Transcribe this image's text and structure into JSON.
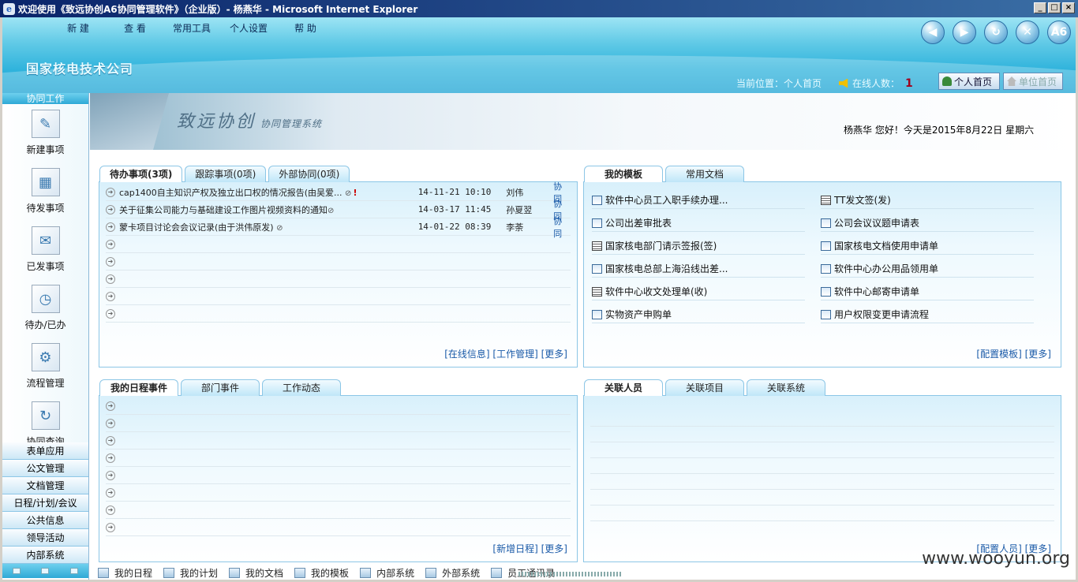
{
  "window": {
    "title": "欢迎使用《致远协创A6协同管理软件》（企业版）- 杨燕华 - Microsoft Internet Explorer",
    "buttons": [
      "_",
      "□",
      "×"
    ]
  },
  "header": {
    "menu": [
      "新 建",
      "查 看",
      "常用工具",
      "个人设置",
      "帮 助"
    ],
    "company": "国家核电技术公司",
    "circle_buttons": [
      "◀",
      "▶",
      "↻",
      "✕",
      "A6"
    ],
    "location_label": "当前位置：",
    "location_value": "个人首页",
    "online_label": "在线人数：",
    "online_count": "1",
    "home_button": "个人首页",
    "dept_button": "单位首页"
  },
  "sidebar": {
    "head": "协同工作",
    "items": [
      {
        "label": "新建事项",
        "icon": "new-item-icon"
      },
      {
        "label": "待发事项",
        "icon": "pending-send-icon"
      },
      {
        "label": "已发事项",
        "icon": "sent-icon"
      },
      {
        "label": "待办/已办",
        "icon": "todo-done-icon"
      },
      {
        "label": "流程管理",
        "icon": "flow-icon"
      },
      {
        "label": "协同查询",
        "icon": "query-icon"
      }
    ],
    "nav": [
      "表单应用",
      "公文管理",
      "文档管理",
      "日程/计划/会议",
      "公共信息",
      "领导活动",
      "内部系统"
    ]
  },
  "banner": {
    "logo": "致远协创",
    "sub": "协同管理系统"
  },
  "greeting": "杨燕华 您好！今天是2015年8月22日 星期六",
  "todo_panel": {
    "tabs": [
      "待办事项(3项)",
      "跟踪事项(0项)",
      "外部协同(0项)"
    ],
    "rows": [
      {
        "subject": "cap1400自主知识产权及独立出口权的情况报告(由吴爱...",
        "time": "14-11-21 10:10",
        "who": "刘伟",
        "type": "协同",
        "clip": true,
        "important": true
      },
      {
        "subject": "关于征集公司能力与基础建设工作图片视频资料的通知",
        "time": "14-03-17 11:45",
        "who": "孙夏翌",
        "type": "协同",
        "clip": true,
        "important": false
      },
      {
        "subject": "蒙卡项目讨论会会议记录(由于洪伟原发)",
        "time": "14-01-22 08:39",
        "who": "李荼",
        "type": "协同",
        "clip": true,
        "important": false
      }
    ],
    "links": [
      "[在线信息]",
      "[工作管理]",
      "[更多]"
    ]
  },
  "template_panel": {
    "tabs": [
      "我的模板",
      "常用文档"
    ],
    "items": [
      {
        "label": "软件中心员工入职手续办理...",
        "kind": "form"
      },
      {
        "label": "TT发文签(发)",
        "kind": "doc"
      },
      {
        "label": "公司出差审批表",
        "kind": "form"
      },
      {
        "label": "公司会议议题申请表",
        "kind": "form"
      },
      {
        "label": "国家核电部门请示签报(签)",
        "kind": "doc"
      },
      {
        "label": "国家核电文档使用申请单",
        "kind": "form"
      },
      {
        "label": "国家核电总部上海沿线出差...",
        "kind": "form"
      },
      {
        "label": "软件中心办公用品领用单",
        "kind": "form"
      },
      {
        "label": "软件中心收文处理单(收)",
        "kind": "doc"
      },
      {
        "label": "软件中心邮寄申请单",
        "kind": "form"
      },
      {
        "label": "实物资产申购单",
        "kind": "form"
      },
      {
        "label": "用户权限变更申请流程",
        "kind": "form"
      }
    ],
    "links": [
      "[配置模板]",
      "[更多]"
    ]
  },
  "schedule_panel": {
    "tabs": [
      "我的日程事件",
      "部门事件",
      "工作动态"
    ],
    "links": [
      "[新增日程]",
      "[更多]"
    ]
  },
  "related_panel": {
    "tabs": [
      "关联人员",
      "关联项目",
      "关联系统"
    ],
    "links": [
      "[配置人员]",
      "[更多]"
    ]
  },
  "bottombar": [
    "我的日程",
    "我的计划",
    "我的文档",
    "我的模板",
    "内部系统",
    "外部系统",
    "员工通讯录"
  ],
  "watermark": "www.wooyun.org",
  "colors": {
    "accent": "#2fb3dc",
    "link": "#1a5aa8",
    "important": "#cc0000"
  }
}
